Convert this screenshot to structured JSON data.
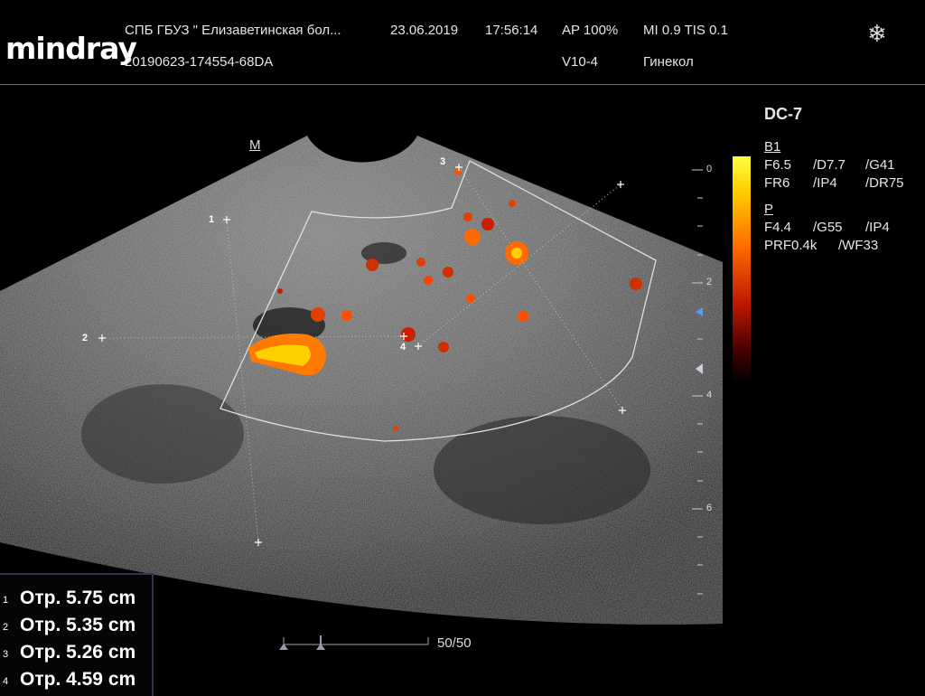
{
  "header": {
    "logo": "mindray",
    "institution": "СПБ ГБУЗ \" Елизаветинская бол...",
    "date": "23.06.2019",
    "time": "17:56:14",
    "ap": "AP 100%",
    "mi_tis": "MI 0.9 TIS 0.1",
    "exam_id": "20190623-174554-68DA",
    "probe": "V10-4",
    "preset": "Гинекол"
  },
  "panel": {
    "mode": "DC-7",
    "b1_head": "B1",
    "b1_row1": [
      "F6.5",
      "/D7.7",
      "/G41"
    ],
    "b1_row2": [
      "FR6",
      "/IP4",
      "/DR75"
    ],
    "p_head": "P",
    "p_row1": [
      "F4.4",
      "/G55",
      "/IP4"
    ],
    "p_row2": [
      "PRF0.4k",
      "/WF33"
    ]
  },
  "depth_scale": [
    "0",
    "2",
    "4",
    "6"
  ],
  "orientation_marker": "M",
  "markers": [
    "1",
    "2",
    "3",
    "4"
  ],
  "measurements": [
    {
      "index": "1",
      "text": "Отр.  5.75 cm"
    },
    {
      "index": "2",
      "text": "Отр.  5.35 cm"
    },
    {
      "index": "3",
      "text": "Отр.  5.26 cm"
    },
    {
      "index": "4",
      "text": "Отр.  4.59 cm"
    }
  ],
  "frame_counter": "50/50",
  "colors": {
    "accent": "#ffcc00",
    "frame_line": "#e0e0e0",
    "panel_border": "#2a3550"
  }
}
